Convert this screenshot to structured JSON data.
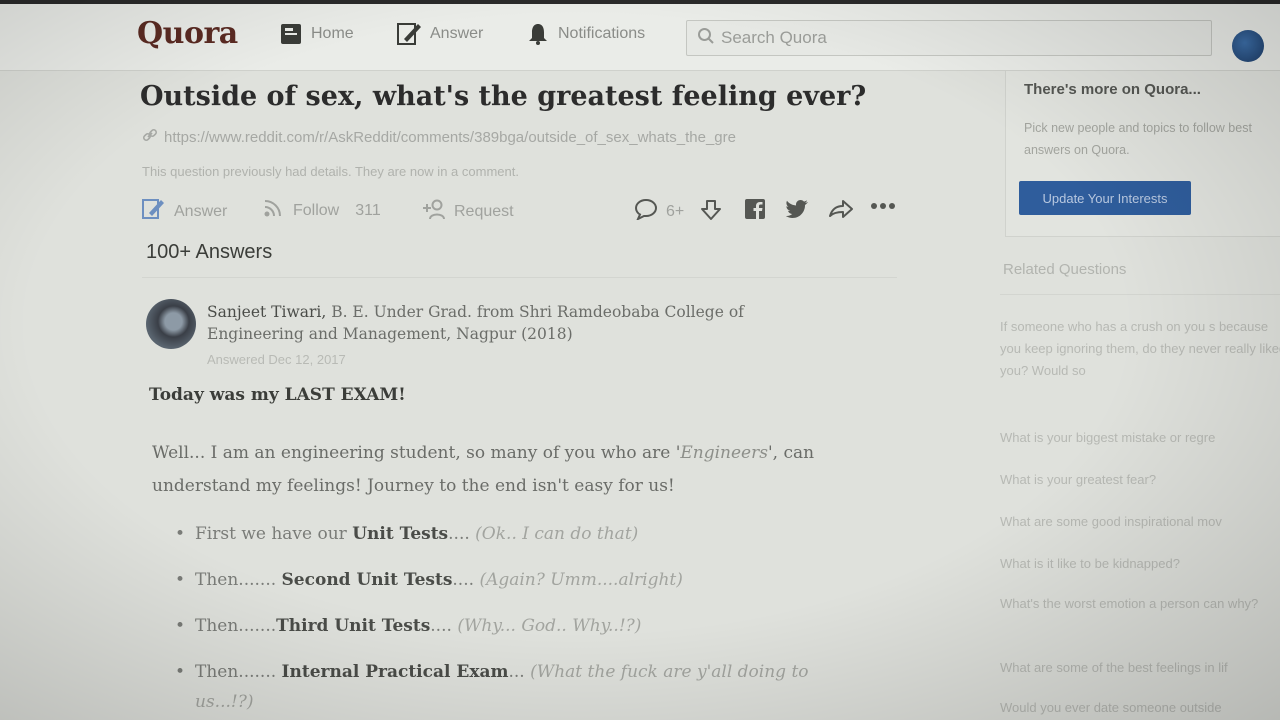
{
  "header": {
    "logo": "Quora",
    "nav": [
      {
        "label": "Home",
        "icon": "home-icon"
      },
      {
        "label": "Answer",
        "icon": "pencil-icon"
      },
      {
        "label": "Notifications",
        "icon": "bell-icon"
      }
    ],
    "search_placeholder": "Search Quora"
  },
  "question": {
    "title": "Outside of sex, what's the greatest feeling ever?",
    "link": "https://www.reddit.com/r/AskReddit/comments/389bga/outside_of_sex_whats_the_gre",
    "details_note": "This question previously had details. They are now in a comment.",
    "actions": {
      "answer": "Answer",
      "follow": "Follow",
      "follow_count": "311",
      "request": "Request",
      "comments": "6+"
    },
    "answer_count": "100+ Answers"
  },
  "answer": {
    "author_name": "Sanjeet Tiwari,",
    "credential": "B. E. Under Grad. from Shri Ramdeobaba College of Engineering and Management, Nagpur (2018)",
    "answered_date": "Answered Dec 12, 2017",
    "bold_line": "Today was my LAST EXAM!",
    "intro_a": "Well... I am an engineering student, so many of you who are '",
    "intro_italic": "Engineers",
    "intro_b": "', can understand my feelings! Journey to the end isn't easy for us!",
    "bullets": [
      {
        "pre": "First we have our ",
        "bold": "Unit Tests",
        "post": ".... ",
        "italic": "(Ok.. I can do that)"
      },
      {
        "pre": "Then....... ",
        "bold": "Second Unit Tests",
        "post": ".... ",
        "italic": "(Again? Umm....alright)"
      },
      {
        "pre": "Then.......",
        "bold": "Third Unit Tests",
        "post": ".... ",
        "italic": "(Why... God.. Why..!?)"
      },
      {
        "pre": "Then....... ",
        "bold": "Internal Practical Exam",
        "post": "... ",
        "italic": "(What the fuck are y'all doing to us...!?)"
      }
    ]
  },
  "sidebar": {
    "more_title": "There's more on Quora...",
    "more_desc": "Pick new people and topics to follow best answers on Quora.",
    "update_button": "Update Your Interests",
    "related_title": "Related Questions",
    "related": [
      "If someone who has a crush on you s because you keep ignoring them, do they never really liked you? Would so",
      "What is your biggest mistake or regre",
      "What is your greatest fear?",
      "What are some good inspirational mov",
      "What is it like to be kidnapped?",
      "What's the worst emotion a person can why?",
      "What are some of the best feelings in lif",
      "Would you ever date someone outside"
    ]
  }
}
